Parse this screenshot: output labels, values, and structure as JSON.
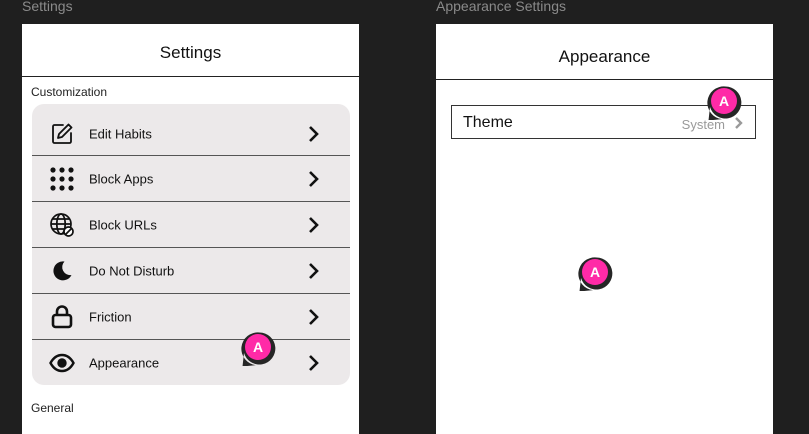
{
  "frames": {
    "settings": {
      "caption": "Settings",
      "header_title": "Settings",
      "section_customization": "Customization",
      "section_general": "General",
      "items": [
        {
          "label": "Edit Habits",
          "icon": "edit-icon"
        },
        {
          "label": "Block Apps",
          "icon": "grid-dots-icon"
        },
        {
          "label": "Block URLs",
          "icon": "globe-blocked-icon"
        },
        {
          "label": "Do Not Disturb",
          "icon": "moon-icon"
        },
        {
          "label": "Friction",
          "icon": "lock-icon"
        },
        {
          "label": "Appearance",
          "icon": "eye-icon"
        }
      ]
    },
    "appearance": {
      "caption": "Appearance Settings",
      "header_title": "Appearance",
      "theme_label": "Theme",
      "theme_value": "System"
    }
  },
  "markers": [
    {
      "label": "A"
    },
    {
      "label": "A"
    },
    {
      "label": "A"
    }
  ],
  "colors": {
    "canvas": "#1f1f1f",
    "marker_fill": "#ff2aa7",
    "group_bg": "#ece9ea"
  }
}
